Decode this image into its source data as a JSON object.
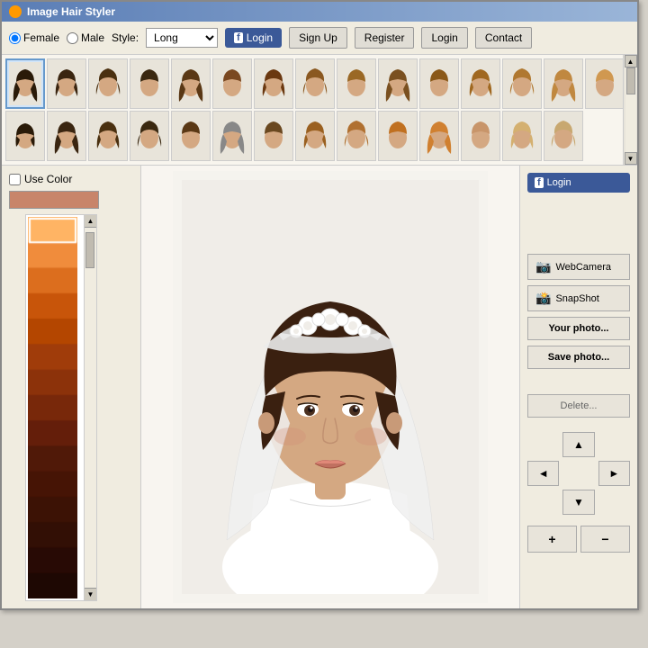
{
  "window": {
    "title": "Image Hair Styler"
  },
  "toolbar": {
    "gender_female": "Female",
    "gender_male": "Male",
    "style_label": "Style:",
    "style_value": "Long",
    "btn_login_fb": "Login",
    "btn_signup": "Sign Up",
    "btn_register": "Register",
    "btn_login": "Login",
    "btn_contact": "Contact"
  },
  "left_panel": {
    "use_color_label": "Use Color",
    "color_hex": "#c8856a"
  },
  "right_panel": {
    "btn_webcamera": "WebCamera",
    "btn_snapshot": "SnapShot",
    "btn_your_photo": "Your photo...",
    "btn_save_photo": "Save photo...",
    "btn_delete": "Delete...",
    "nav_up": "▲",
    "nav_left": "◄",
    "nav_right": "►",
    "nav_down": "▼",
    "zoom_plus": "+",
    "zoom_minus": "−"
  },
  "hair_styles": [
    {
      "id": 1,
      "color": "#3a2515",
      "selected": true
    },
    {
      "id": 2,
      "color": "#4a3020"
    },
    {
      "id": 3,
      "color": "#6b3a1f"
    },
    {
      "id": 4,
      "color": "#5a3010"
    },
    {
      "id": 5,
      "color": "#8b5e30"
    },
    {
      "id": 6,
      "color": "#7a4010"
    },
    {
      "id": 7,
      "color": "#9a6020"
    },
    {
      "id": 8,
      "color": "#b07030"
    },
    {
      "id": 9,
      "color": "#c08040"
    },
    {
      "id": 10,
      "color": "#d09050"
    },
    {
      "id": 11,
      "color": "#c07020"
    },
    {
      "id": 12,
      "color": "#d08030"
    },
    {
      "id": 13,
      "color": "#e09040"
    },
    {
      "id": 14,
      "color": "#c8a060"
    },
    {
      "id": 15,
      "color": "#d8b070"
    },
    {
      "id": 16,
      "color": "#3a2515"
    },
    {
      "id": 17,
      "color": "#4a3020"
    },
    {
      "id": 18,
      "color": "#6b3a1f"
    },
    {
      "id": 19,
      "color": "#5a3010"
    },
    {
      "id": 20,
      "color": "#7a4010"
    },
    {
      "id": 21,
      "color": "#888888"
    },
    {
      "id": 22,
      "color": "#6b3a1f"
    },
    {
      "id": 23,
      "color": "#9a6020"
    },
    {
      "id": 24,
      "color": "#b07030"
    },
    {
      "id": 25,
      "color": "#d09050"
    },
    {
      "id": 26,
      "color": "#c07020"
    },
    {
      "id": 27,
      "color": "#7a5030"
    },
    {
      "id": 28,
      "color": "#c8956a"
    },
    {
      "id": 29,
      "color": "#d4a020"
    }
  ],
  "palette_colors": [
    "#f08030",
    "#e87020",
    "#d86010",
    "#c85010",
    "#b84000",
    "#a83000",
    "#983020",
    "#882010",
    "#781000",
    "#681000",
    "#582000",
    "#482800",
    "#382000",
    "#281800",
    "#181000"
  ]
}
